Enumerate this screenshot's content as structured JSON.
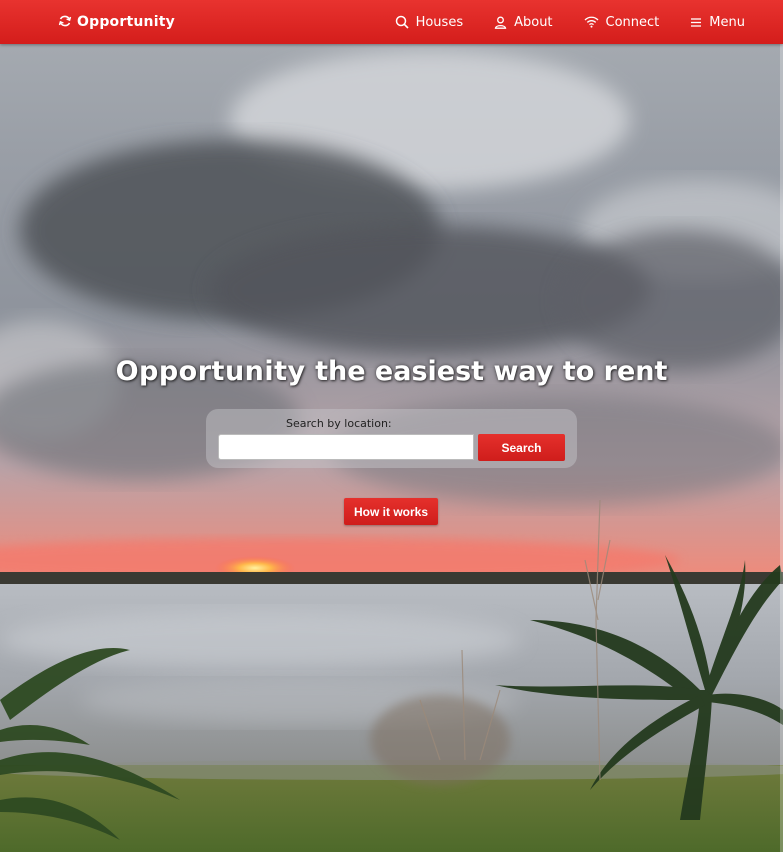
{
  "navbar": {
    "brand": "Opportunity",
    "items": [
      {
        "label": "Houses",
        "icon": "search-icon"
      },
      {
        "label": "About",
        "icon": "user-icon"
      },
      {
        "label": "Connect",
        "icon": "wifi-icon"
      },
      {
        "label": "Menu",
        "icon": "menu-icon"
      }
    ]
  },
  "hero": {
    "title_brand": "Opportunity",
    "title_rest": " the easiest way to rent",
    "search_label": "Search by location:",
    "search_value": "",
    "search_button": "Search",
    "how_button": "How it works"
  },
  "colors": {
    "brand_red": "#dc2320",
    "button_red": "#d82320",
    "text_light": "#ffffff"
  }
}
